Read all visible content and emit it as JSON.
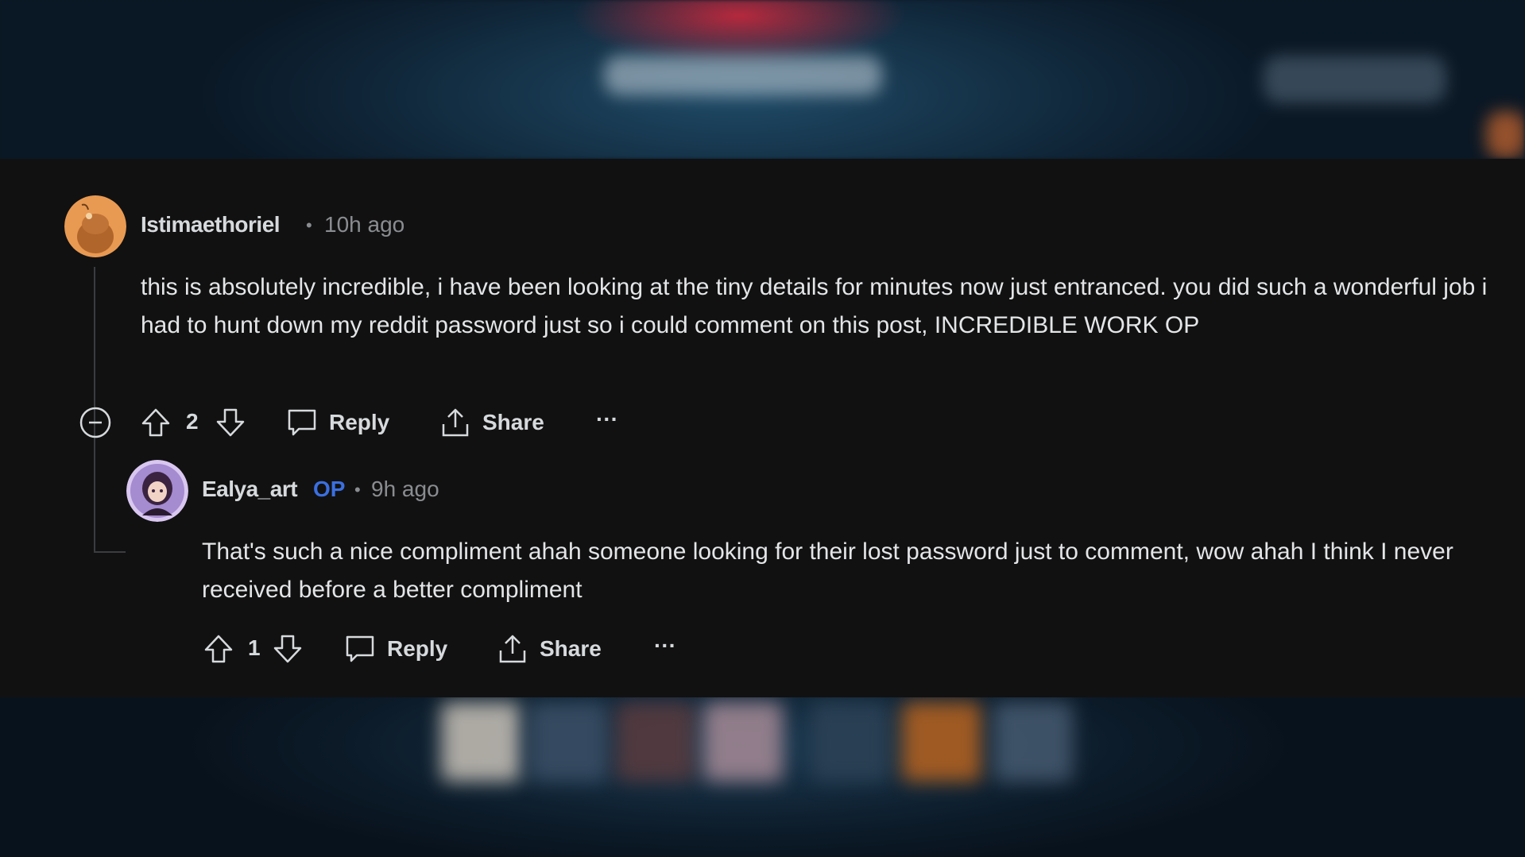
{
  "comment1": {
    "username": "Istimaethoriel",
    "separator": "•",
    "time": "10h ago",
    "text": "this is absolutely incredible, i have been looking at the tiny details for minutes now just entranced. you did such a wonderful job i had to hunt down my reddit password just so i could comment on this post, INCREDIBLE WORK OP",
    "votes": "2",
    "reply_label": "Reply",
    "share_label": "Share",
    "more_label": "···"
  },
  "comment2": {
    "username": "Ealya_art",
    "op_badge": "OP",
    "separator": "•",
    "time": "9h ago",
    "text": "That's such a nice compliment ahah someone looking for their lost password just to comment, wow ahah I think I never received before a better compliment",
    "votes": "1",
    "reply_label": "Reply",
    "share_label": "Share",
    "more_label": "···"
  },
  "colors": {
    "panel_bg": "#111112",
    "text": "#d7dadc",
    "meta": "#8a8d90",
    "op_badge": "#3b6fe0"
  },
  "icons": {
    "collapse": "minus-circle-icon",
    "upvote": "arrow-up-icon",
    "downvote": "arrow-down-icon",
    "reply": "speech-bubble-icon",
    "share": "share-upload-icon",
    "more": "ellipsis-icon"
  }
}
